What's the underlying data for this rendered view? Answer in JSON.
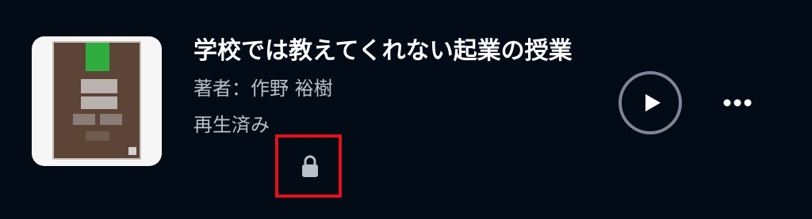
{
  "book": {
    "title": "学校では教えてくれない起業の授業",
    "author": "著者：作野 裕樹",
    "status": "再生済み"
  },
  "icons": {
    "status": "lock-icon",
    "play": "play-icon",
    "more": "more-horizontal-icon"
  },
  "colors": {
    "background": "#030b16",
    "text_primary": "#ffffff",
    "text_secondary": "#b9c0c8",
    "play_ring": "#7b8796",
    "highlight_border": "#e0121b"
  }
}
